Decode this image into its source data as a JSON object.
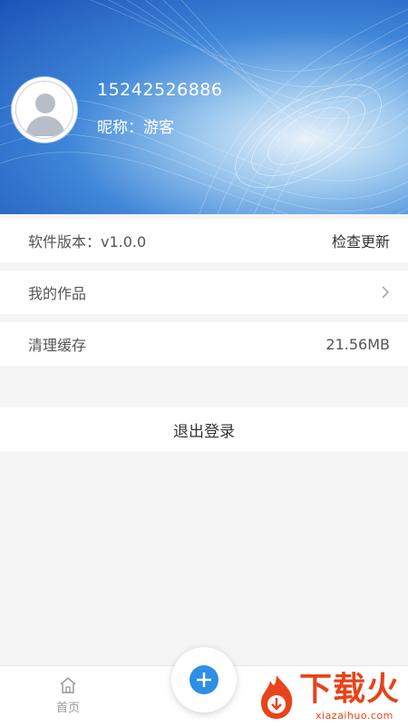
{
  "profile": {
    "phone": "15242526886",
    "nickname": "昵称：游客"
  },
  "settings": {
    "version_label": "软件版本：v1.0.0",
    "check_update": "检查更新",
    "my_works": "我的作品",
    "clear_cache": "清理缓存",
    "cache_size": "21.56MB",
    "logout": "退出登录"
  },
  "bottom_nav": {
    "home": "首页"
  },
  "watermark": {
    "brand": "下载火",
    "domain": "xiazaihuo.com"
  },
  "colors": {
    "accent": "#2f8ee6",
    "header_blue": "#1a53b8",
    "watermark": "#e8431b"
  }
}
